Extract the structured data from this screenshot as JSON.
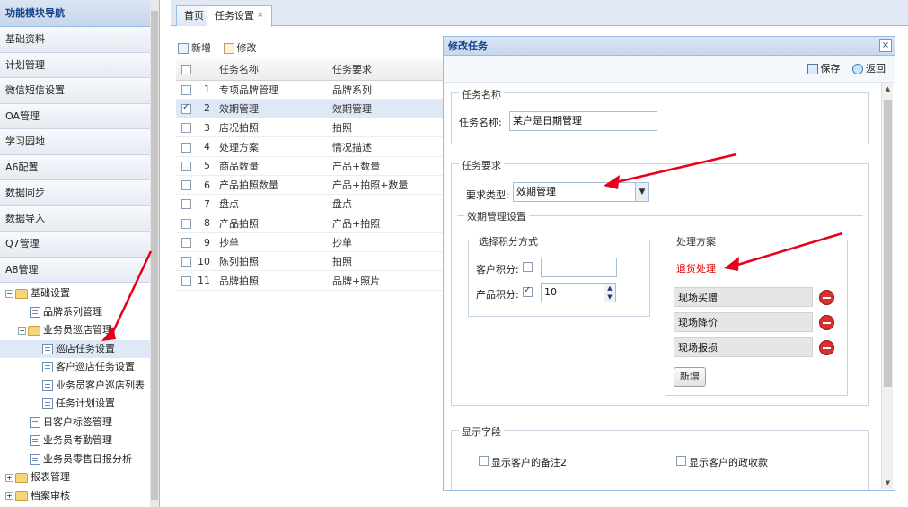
{
  "sidebar": {
    "title": "功能模块导航",
    "categories": [
      "基础资料",
      "计划管理",
      "微信短信设置",
      "OA管理",
      "学习园地",
      "A6配置",
      "数据同步",
      "数据导入",
      "Q7管理",
      "A8管理"
    ],
    "tree": [
      {
        "level": 0,
        "kind": "folder",
        "toggle": "−",
        "label": "基础设置"
      },
      {
        "level": 1,
        "kind": "doc",
        "label": "品牌系列管理"
      },
      {
        "level": 1,
        "kind": "folder",
        "toggle": "−",
        "label": "业务员巡店管理"
      },
      {
        "level": 2,
        "kind": "doc",
        "label": "巡店任务设置",
        "selected": true
      },
      {
        "level": 2,
        "kind": "doc",
        "label": "客户巡店任务设置"
      },
      {
        "level": 2,
        "kind": "doc",
        "label": "业务员客户巡店列表"
      },
      {
        "level": 2,
        "kind": "doc",
        "label": "任务计划设置"
      },
      {
        "level": 1,
        "kind": "doc",
        "label": "日客户标签管理"
      },
      {
        "level": 1,
        "kind": "doc",
        "label": "业务员考勤管理"
      },
      {
        "level": 1,
        "kind": "doc",
        "label": "业务员零售日报分析"
      },
      {
        "level": 0,
        "kind": "folder",
        "toggle": "+",
        "label": "报表管理"
      },
      {
        "level": 0,
        "kind": "folder",
        "toggle": "+",
        "label": "档案审核"
      }
    ]
  },
  "tabs": [
    {
      "label": "首页",
      "active": false
    },
    {
      "label": "任务设置",
      "active": true,
      "close": "×"
    }
  ],
  "toolbar": {
    "add_label": "新增",
    "edit_label": "修改"
  },
  "grid": {
    "headers": [
      "任务名称",
      "任务要求"
    ],
    "rows": [
      {
        "n": "1",
        "name": "专项品牌管理",
        "req": "品牌系列",
        "checked": false
      },
      {
        "n": "2",
        "name": "效期管理",
        "req": "效期管理",
        "checked": true
      },
      {
        "n": "3",
        "name": "店况拍照",
        "req": "拍照",
        "checked": false
      },
      {
        "n": "4",
        "name": "处理方案",
        "req": "情况描述",
        "checked": false
      },
      {
        "n": "5",
        "name": "商品数量",
        "req": "产品+数量",
        "checked": false
      },
      {
        "n": "6",
        "name": "产品拍照数量",
        "req": "产品+拍照+数量",
        "checked": false
      },
      {
        "n": "7",
        "name": "盘点",
        "req": "盘点",
        "checked": false
      },
      {
        "n": "8",
        "name": "产品拍照",
        "req": "产品+拍照",
        "checked": false
      },
      {
        "n": "9",
        "name": "抄单",
        "req": "抄单",
        "checked": false
      },
      {
        "n": "10",
        "name": "陈列拍照",
        "req": "拍照",
        "checked": false
      },
      {
        "n": "11",
        "name": "品牌拍照",
        "req": "品牌+照片",
        "checked": false
      }
    ]
  },
  "modal": {
    "title": "修改任务",
    "close": "×",
    "save_label": "保存",
    "back_label": "返回",
    "task_name_legend": "任务名称",
    "task_name_label": "任务名称:",
    "task_name_value": "某户是日期管理",
    "req_legend": "任务要求",
    "req_type_label": "要求类型:",
    "req_type_value": "效期管理",
    "effect_legend": "效期管理设置",
    "score_legend": "选择积分方式",
    "customer_score_label": "客户积分:",
    "product_score_label": "产品积分:",
    "product_score_value": "10",
    "plan_legend": "处理方案",
    "plan_default": "退货处理",
    "plan_items": [
      "现场买赠",
      "现场降价",
      "现场报损"
    ],
    "add_label": "新增",
    "display_legend": "显示字段",
    "display_fields": [
      "显示客户的备注2",
      "显示客户的政收款"
    ]
  },
  "colors": {
    "annotation": "#e8001a",
    "accent": "#15428b"
  }
}
